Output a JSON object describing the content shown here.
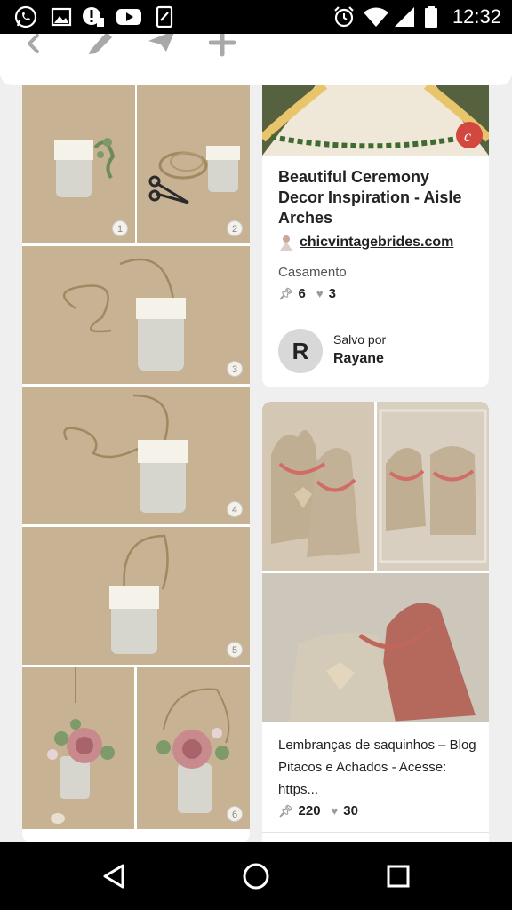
{
  "status_bar": {
    "time": "12:32",
    "left_icons": [
      "whatsapp-icon",
      "gallery-icon",
      "alert-icon",
      "youtube-icon",
      "sim-app-icon"
    ],
    "right_icons": [
      "alarm-icon",
      "wifi-icon",
      "signal-icon",
      "battery-icon"
    ]
  },
  "toolbar": {
    "icons": [
      "back-icon",
      "edit-icon",
      "send-icon",
      "add-icon"
    ]
  },
  "left_pin": {
    "steps": [
      "1",
      "2",
      "3",
      "4",
      "5",
      "6"
    ]
  },
  "pins": {
    "ceremony": {
      "title": "Beautiful Ceremony Decor Inspiration - Aisle Arches",
      "source": "chicvintagebrides.com",
      "board": "Casamento",
      "saves": "6",
      "likes": "3",
      "saved_by_label": "Salvo por",
      "saved_by_user": "Rayane",
      "avatar_letter": "R"
    },
    "saquinhos": {
      "description": "Lembranças de saquinhos – Blog Pitacos e Achados - Acesse: https...",
      "saves": "220",
      "likes": "30"
    }
  },
  "nav_bar": {
    "icons": [
      "back-triangle-icon",
      "home-circle-icon",
      "recents-square-icon"
    ]
  },
  "colors": {
    "background": "#efefef",
    "card": "#ffffff",
    "brand_red": "#e60023",
    "kraft": "#c7b293"
  }
}
